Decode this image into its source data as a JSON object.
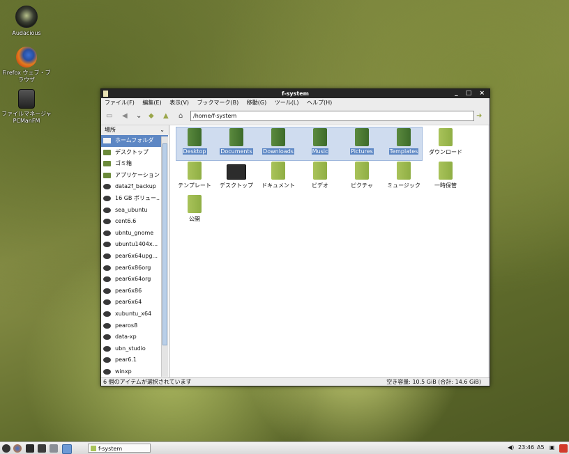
{
  "desktop": {
    "icons": [
      {
        "label": "Audacious",
        "icon": "audacious-icon"
      },
      {
        "label": "Firefox ウェブ・ブラウザ",
        "icon": "firefox-icon"
      },
      {
        "label": "ファイルマネージャ PCManFM",
        "icon": "file-manager-icon"
      }
    ]
  },
  "window": {
    "title": "f-system",
    "controls": [
      "_",
      "□",
      "×"
    ],
    "menu": [
      "ファイル(F)",
      "編集(E)",
      "表示(V)",
      "ブックマーク(B)",
      "移動(G)",
      "ツール(L)",
      "ヘルプ(H)"
    ],
    "path": "/home/f-system",
    "sidebar": {
      "header": "場所",
      "items": [
        {
          "label": "ホームフォルダ",
          "selected": true
        },
        {
          "label": "デスクトップ"
        },
        {
          "label": "ゴミ箱"
        },
        {
          "label": "アプリケーション"
        },
        {
          "label": "data2f_backup"
        },
        {
          "label": "16 GB ボリュー..."
        },
        {
          "label": "sea_ubuntu"
        },
        {
          "label": "cent6.6"
        },
        {
          "label": "ubntu_gnome"
        },
        {
          "label": "ubuntu1404x..."
        },
        {
          "label": "pear6x64upg..."
        },
        {
          "label": "pear6x86org"
        },
        {
          "label": "pear6x64org"
        },
        {
          "label": "pear6x86"
        },
        {
          "label": "pear6x64"
        },
        {
          "label": "xubuntu_x64"
        },
        {
          "label": "pearos8"
        },
        {
          "label": "data-xp"
        },
        {
          "label": "ubn_studio"
        },
        {
          "label": "pear6.1"
        },
        {
          "label": "winxp"
        }
      ]
    },
    "files": [
      {
        "label": "Desktop",
        "selected": true
      },
      {
        "label": "Documents",
        "selected": true
      },
      {
        "label": "Downloads",
        "selected": true
      },
      {
        "label": "Music",
        "selected": true
      },
      {
        "label": "Pictures",
        "selected": true
      },
      {
        "label": "Templates",
        "selected": true
      },
      {
        "label": "ダウンロード"
      },
      {
        "label": "テンプレート"
      },
      {
        "label": "デスクトップ"
      },
      {
        "label": "ドキュメント"
      },
      {
        "label": "ビデオ"
      },
      {
        "label": "ピクチャ"
      },
      {
        "label": "ミュージック"
      },
      {
        "label": "一時保管"
      },
      {
        "label": "公開"
      }
    ],
    "status_left": "6 個のアイテムが選択されています",
    "status_right": "空き容量: 10.5 GiB (合計: 14.6 GiB)"
  },
  "taskbar": {
    "task_label": "f-system",
    "clock": "23:46",
    "ime": "A5"
  }
}
